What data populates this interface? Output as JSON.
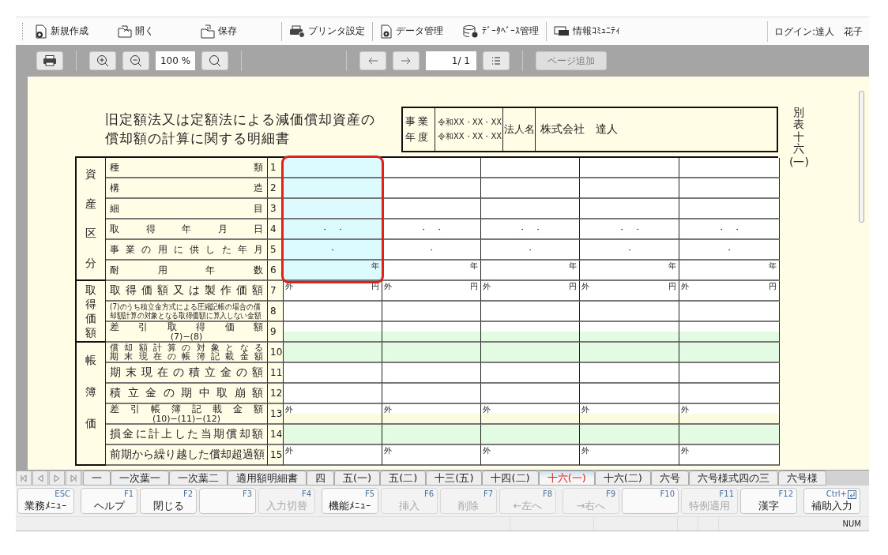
{
  "toolbar": {
    "items": [
      {
        "kind": "new",
        "label": "新規作成",
        "separator_before": false
      },
      {
        "kind": "open",
        "label": "開く",
        "separator_before": false
      },
      {
        "kind": "save",
        "label": "保存",
        "separator_before": false
      },
      {
        "kind": "printer",
        "label": "プリンタ設定",
        "separator_before": true
      },
      {
        "kind": "data",
        "label": "データ管理",
        "separator_before": true
      },
      {
        "kind": "database",
        "label": "ﾃﾞｰﾀﾍﾞｰｽ管理",
        "separator_before": false
      },
      {
        "kind": "community",
        "label": "情報ｺﾐｭﾆﾃｨ",
        "separator_before": true
      }
    ],
    "login": "ログイン:達人　花子"
  },
  "viewer": {
    "zoom": "100 %",
    "page": "1/ 1",
    "add_page": {
      "label": "ページ追加",
      "disabled": true
    }
  },
  "form": {
    "title_lines": [
      "旧定額法又は定額法による減価償却資産の",
      "償却額の計算に関する明細書"
    ],
    "fiscal_label": "事業年度",
    "period_start": "令和XX・XX・XX",
    "period_end": "令和XX・XX・XX",
    "corp_label": "法人名",
    "corp_name": "株式会社　達人",
    "form_number": "別表十六",
    "form_sub": "(一)",
    "value_columns": [
      {
        "selected": true
      },
      {
        "selected": false
      },
      {
        "selected": false
      },
      {
        "selected": false
      },
      {
        "selected": false
      }
    ],
    "groups": [
      {
        "label": "資産区分",
        "selected": true,
        "rows": [
          {
            "no": "1",
            "kind": "small",
            "label": "種類"
          },
          {
            "no": "2",
            "kind": "small",
            "label": "構造"
          },
          {
            "no": "3",
            "kind": "small",
            "label": "細目"
          },
          {
            "no": "4",
            "kind": "small",
            "label": "取得年月日",
            "cells": [
              {
                "mid": "・　・"
              },
              {
                "mid": "・　・"
              },
              {
                "mid": "・　・"
              },
              {
                "mid": "・　・"
              },
              {
                "mid": "・　・"
              }
            ]
          },
          {
            "no": "5",
            "kind": "small",
            "label": "事業の用に供した年月",
            "cells": [
              {
                "mid": "・"
              },
              {
                "mid": "・"
              },
              {
                "mid": "・"
              },
              {
                "mid": "・"
              },
              {
                "mid": "・"
              }
            ]
          },
          {
            "no": "6",
            "kind": "small",
            "label": "耐用年数",
            "cells": [
              {
                "right": "年"
              },
              {
                "right": "年"
              },
              {
                "right": "年"
              },
              {
                "right": "年"
              },
              {
                "right": "年"
              }
            ]
          }
        ]
      },
      {
        "label": "取得価額",
        "selected": false,
        "rows": [
          {
            "no": "7",
            "kind": "large",
            "label": "取得価額又は製作価額",
            "cells": [
              {
                "left": "外",
                "right": "円"
              },
              {
                "left": "外",
                "right": "円"
              },
              {
                "left": "外",
                "right": "円"
              },
              {
                "left": "外",
                "right": "円"
              },
              {
                "left": "外",
                "right": "円"
              }
            ]
          },
          {
            "no": "8",
            "kind": "note",
            "lines": [
              "(7)のうち積立金方式による圧縮記帳の場合の償",
              "却額計算の対象となる取得価額に算入しない金額"
            ]
          },
          {
            "no": "9",
            "kind": "formula",
            "label": "差引取得価額",
            "formula": "(7)−(8)",
            "lower_band": {
              "color": "#e2fbe2"
            }
          }
        ]
      },
      {
        "label": "帳簿価",
        "selected": false,
        "rows": [
          {
            "no": "10",
            "kind": "double",
            "lines": [
              "償却額計算の対象となる",
              "期末現在の帳簿記載金額"
            ],
            "color": "#e2fbe2"
          },
          {
            "no": "11",
            "kind": "large",
            "label": "期末現在の積立金の額"
          },
          {
            "no": "12",
            "kind": "large",
            "label": "積立金の期中取崩額"
          },
          {
            "no": "13",
            "kind": "formula",
            "label": "差引帳簿記載金額",
            "formula": "(10)−(11)−(12)",
            "lower_band": {
              "color": "#fcfbe0"
            },
            "cells": [
              {
                "left": "外"
              },
              {
                "left": "外"
              },
              {
                "left": "外"
              },
              {
                "left": "外"
              },
              {
                "left": "外"
              }
            ]
          },
          {
            "no": "14",
            "kind": "large",
            "label": "損金に計上した当期償却額",
            "color": "#e2fbe2"
          },
          {
            "no": "15",
            "kind": "large",
            "label": "前期から繰り越した償却超過額",
            "cells": [
              {
                "left": "外"
              },
              {
                "left": "外"
              },
              {
                "left": "外"
              },
              {
                "left": "外"
              },
              {
                "left": "外"
              }
            ]
          }
        ]
      }
    ]
  },
  "sheet_tabs": [
    {
      "label": "一",
      "selected": false
    },
    {
      "label": "一次葉一",
      "selected": false
    },
    {
      "label": "一次葉二",
      "selected": false
    },
    {
      "label": "適用額明細書",
      "selected": false
    },
    {
      "label": "四",
      "selected": false
    },
    {
      "label": "五(一)",
      "selected": false
    },
    {
      "label": "五(二)",
      "selected": false
    },
    {
      "label": "十三(五)",
      "selected": false
    },
    {
      "label": "十四(二)",
      "selected": false
    },
    {
      "label": "十六(一)",
      "selected": true
    },
    {
      "label": "十六(二)",
      "selected": false
    },
    {
      "label": "六号",
      "selected": false
    },
    {
      "label": "六号様式四の三",
      "selected": false
    },
    {
      "label": "六号様",
      "selected": false
    }
  ],
  "function_keys": [
    {
      "key": "ESC",
      "label": "業務ﾒﾆｭｰ",
      "disabled": false
    },
    {
      "key": "F1",
      "label": "ヘルプ",
      "disabled": false
    },
    {
      "key": "F2",
      "label": "閉じる",
      "disabled": false
    },
    {
      "key": "F3",
      "disabled": false
    },
    {
      "key": "F4",
      "label": "入力切替",
      "disabled": true
    },
    {
      "key": "F5",
      "label": "機能ﾒﾆｭｰ",
      "disabled": false
    },
    {
      "key": "F6",
      "label": "挿入",
      "disabled": true
    },
    {
      "key": "F7",
      "label": "削除",
      "disabled": true
    },
    {
      "key": "F8",
      "label": "←左へ",
      "disabled": true
    },
    {
      "key": "F9",
      "label": "→右へ",
      "disabled": true
    },
    {
      "key": "F10",
      "disabled": false
    },
    {
      "key": "F11",
      "label": "特例適用",
      "disabled": true
    },
    {
      "key": "F12",
      "label": "漢字",
      "disabled": false
    },
    {
      "key": "Ctrl+",
      "label": "補助入力",
      "disabled": false,
      "kind": "ctrl"
    }
  ],
  "status_bar": {
    "indicator": "NUM"
  }
}
